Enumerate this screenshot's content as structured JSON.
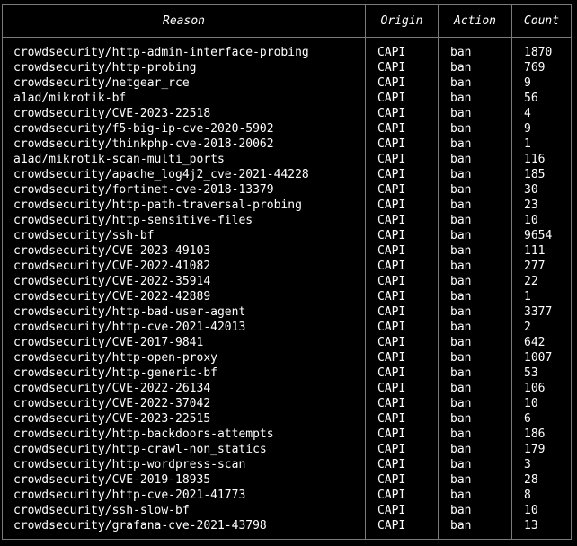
{
  "table": {
    "headers": {
      "reason": "Reason",
      "origin": "Origin",
      "action": "Action",
      "count": "Count"
    },
    "rows": [
      {
        "reason": "crowdsecurity/http-admin-interface-probing",
        "origin": "CAPI",
        "action": "ban",
        "count": "1870"
      },
      {
        "reason": "crowdsecurity/http-probing",
        "origin": "CAPI",
        "action": "ban",
        "count": "769"
      },
      {
        "reason": "crowdsecurity/netgear_rce",
        "origin": "CAPI",
        "action": "ban",
        "count": "9"
      },
      {
        "reason": "a1ad/mikrotik-bf",
        "origin": "CAPI",
        "action": "ban",
        "count": "56"
      },
      {
        "reason": "crowdsecurity/CVE-2023-22518",
        "origin": "CAPI",
        "action": "ban",
        "count": "4"
      },
      {
        "reason": "crowdsecurity/f5-big-ip-cve-2020-5902",
        "origin": "CAPI",
        "action": "ban",
        "count": "9"
      },
      {
        "reason": "crowdsecurity/thinkphp-cve-2018-20062",
        "origin": "CAPI",
        "action": "ban",
        "count": "1"
      },
      {
        "reason": "a1ad/mikrotik-scan-multi_ports",
        "origin": "CAPI",
        "action": "ban",
        "count": "116"
      },
      {
        "reason": "crowdsecurity/apache_log4j2_cve-2021-44228",
        "origin": "CAPI",
        "action": "ban",
        "count": "185"
      },
      {
        "reason": "crowdsecurity/fortinet-cve-2018-13379",
        "origin": "CAPI",
        "action": "ban",
        "count": "30"
      },
      {
        "reason": "crowdsecurity/http-path-traversal-probing",
        "origin": "CAPI",
        "action": "ban",
        "count": "23"
      },
      {
        "reason": "crowdsecurity/http-sensitive-files",
        "origin": "CAPI",
        "action": "ban",
        "count": "10"
      },
      {
        "reason": "crowdsecurity/ssh-bf",
        "origin": "CAPI",
        "action": "ban",
        "count": "9654"
      },
      {
        "reason": "crowdsecurity/CVE-2023-49103",
        "origin": "CAPI",
        "action": "ban",
        "count": "111"
      },
      {
        "reason": "crowdsecurity/CVE-2022-41082",
        "origin": "CAPI",
        "action": "ban",
        "count": "277"
      },
      {
        "reason": "crowdsecurity/CVE-2022-35914",
        "origin": "CAPI",
        "action": "ban",
        "count": "22"
      },
      {
        "reason": "crowdsecurity/CVE-2022-42889",
        "origin": "CAPI",
        "action": "ban",
        "count": "1"
      },
      {
        "reason": "crowdsecurity/http-bad-user-agent",
        "origin": "CAPI",
        "action": "ban",
        "count": "3377"
      },
      {
        "reason": "crowdsecurity/http-cve-2021-42013",
        "origin": "CAPI",
        "action": "ban",
        "count": "2"
      },
      {
        "reason": "crowdsecurity/CVE-2017-9841",
        "origin": "CAPI",
        "action": "ban",
        "count": "642"
      },
      {
        "reason": "crowdsecurity/http-open-proxy",
        "origin": "CAPI",
        "action": "ban",
        "count": "1007"
      },
      {
        "reason": "crowdsecurity/http-generic-bf",
        "origin": "CAPI",
        "action": "ban",
        "count": "53"
      },
      {
        "reason": "crowdsecurity/CVE-2022-26134",
        "origin": "CAPI",
        "action": "ban",
        "count": "106"
      },
      {
        "reason": "crowdsecurity/CVE-2022-37042",
        "origin": "CAPI",
        "action": "ban",
        "count": "10"
      },
      {
        "reason": "crowdsecurity/CVE-2023-22515",
        "origin": "CAPI",
        "action": "ban",
        "count": "6"
      },
      {
        "reason": "crowdsecurity/http-backdoors-attempts",
        "origin": "CAPI",
        "action": "ban",
        "count": "186"
      },
      {
        "reason": "crowdsecurity/http-crawl-non_statics",
        "origin": "CAPI",
        "action": "ban",
        "count": "179"
      },
      {
        "reason": "crowdsecurity/http-wordpress-scan",
        "origin": "CAPI",
        "action": "ban",
        "count": "3"
      },
      {
        "reason": "crowdsecurity/CVE-2019-18935",
        "origin": "CAPI",
        "action": "ban",
        "count": "28"
      },
      {
        "reason": "crowdsecurity/http-cve-2021-41773",
        "origin": "CAPI",
        "action": "ban",
        "count": "8"
      },
      {
        "reason": "crowdsecurity/ssh-slow-bf",
        "origin": "CAPI",
        "action": "ban",
        "count": "10"
      },
      {
        "reason": "crowdsecurity/grafana-cve-2021-43798",
        "origin": "CAPI",
        "action": "ban",
        "count": "13"
      }
    ]
  },
  "colors": {
    "background": "#000000",
    "text": "#ffffff",
    "border": "#7a7a7a"
  }
}
